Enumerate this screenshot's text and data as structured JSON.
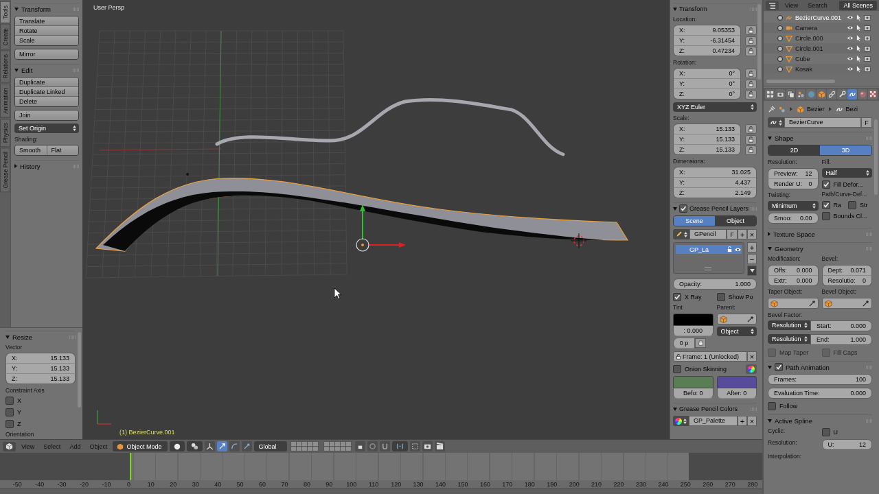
{
  "tool_tabs": [
    {
      "label": "Tools",
      "selected": true
    },
    {
      "label": "Create",
      "selected": false
    },
    {
      "label": "Relations",
      "selected": false
    },
    {
      "label": "Animation",
      "selected": false
    },
    {
      "label": "Physics",
      "selected": false
    },
    {
      "label": "Grease Pencil",
      "selected": false
    }
  ],
  "tool_shelf": {
    "rows": [
      {
        "kind": "section",
        "title": "Transform",
        "expanded": true
      },
      {
        "kind": "buttons",
        "labels": [
          "Translate",
          "Rotate",
          "Scale"
        ]
      },
      {
        "kind": "buttons",
        "labels": [
          "Mirror"
        ]
      },
      {
        "kind": "section",
        "title": "Edit",
        "expanded": true
      },
      {
        "kind": "buttons",
        "labels": [
          "Duplicate",
          "Duplicate Linked",
          "Delete"
        ]
      },
      {
        "kind": "buttons",
        "labels": [
          "Join"
        ]
      },
      {
        "kind": "dropdown",
        "value": "Set Origin"
      },
      {
        "kind": "label",
        "text": "Shading:"
      },
      {
        "kind": "pair",
        "labels": [
          "Smooth",
          "Flat"
        ]
      },
      {
        "kind": "section",
        "title": "History",
        "expanded": false
      }
    ]
  },
  "operator": {
    "rows": [
      {
        "kind": "section",
        "title": "Resize",
        "expanded": true
      },
      {
        "kind": "label",
        "text": "Vector"
      },
      {
        "kind": "fields",
        "locks": false,
        "items": [
          {
            "label": "X:",
            "value": "15.133"
          },
          {
            "label": "Y:",
            "value": "15.133"
          },
          {
            "label": "Z:",
            "value": "15.133"
          }
        ]
      },
      {
        "kind": "label",
        "text": "Constraint Axis"
      },
      {
        "kind": "checkbox",
        "label": "X",
        "checked": false
      },
      {
        "kind": "checkbox",
        "label": "Y",
        "checked": false
      },
      {
        "kind": "checkbox",
        "label": "Z",
        "checked": false
      },
      {
        "kind": "label",
        "text": "Orientation"
      }
    ]
  },
  "viewport": {
    "view_name": "User Persp",
    "object_info": "(1) BezierCurve.001"
  },
  "sidebar": {
    "rows": [
      {
        "kind": "section",
        "title": "Transform",
        "expanded": true
      },
      {
        "kind": "label",
        "text": "Location:"
      },
      {
        "kind": "fields",
        "locks": true,
        "items": [
          {
            "label": "X:",
            "value": "9.05353"
          },
          {
            "label": "Y:",
            "value": "-6.31454"
          },
          {
            "label": "Z:",
            "value": "0.47234"
          }
        ]
      },
      {
        "kind": "label",
        "text": "Rotation:"
      },
      {
        "kind": "fields",
        "locks": true,
        "items": [
          {
            "label": "X:",
            "value": "0°"
          },
          {
            "label": "Y:",
            "value": "0°"
          },
          {
            "label": "Z:",
            "value": "0°"
          }
        ]
      },
      {
        "kind": "dropdown",
        "value": "XYZ Euler"
      },
      {
        "kind": "label",
        "text": "Scale:"
      },
      {
        "kind": "fields",
        "locks": true,
        "items": [
          {
            "label": "X:",
            "value": "15.133"
          },
          {
            "label": "Y:",
            "value": "15.133"
          },
          {
            "label": "Z:",
            "value": "15.133"
          }
        ]
      },
      {
        "kind": "label",
        "text": "Dimensions:"
      },
      {
        "kind": "fields",
        "locks": false,
        "items": [
          {
            "label": "X:",
            "value": "31.025"
          },
          {
            "label": "Y:",
            "value": "4.437"
          },
          {
            "label": "Z:",
            "value": "2.149"
          }
        ]
      },
      {
        "kind": "section",
        "title": "Grease Pencil Layers",
        "expanded": true,
        "checked": true
      },
      {
        "kind": "segmented",
        "options": [
          {
            "label": "Scene",
            "selected": true
          },
          {
            "label": "Object",
            "selected": false
          }
        ]
      },
      {
        "kind": "gpencil_block",
        "name": "GPencil",
        "fake": "F",
        "buttons": [
          "+",
          "×"
        ]
      },
      {
        "kind": "layerlist",
        "items": [
          {
            "name": "GP_La",
            "selected": true
          }
        ],
        "side_buttons": [
          "+",
          "−"
        ]
      },
      {
        "kind": "field",
        "label": "Opacity:",
        "value": "1.000"
      },
      {
        "kind": "cols",
        "columns": [
          [
            {
              "kind": "checkbox",
              "label": "X Ray",
              "checked": true
            }
          ],
          [
            {
              "kind": "checkbox",
              "label": "Show Po",
              "checked": false
            }
          ]
        ]
      },
      {
        "kind": "cols",
        "columns": [
          [
            {
              "kind": "label",
              "text": "Tint"
            },
            {
              "kind": "swatch",
              "color": "#000000",
              "value": ": 0.000"
            },
            {
              "kind": "tiny",
              "value": "0 p"
            }
          ],
          [
            {
              "kind": "label",
              "text": "Parent:"
            },
            {
              "kind": "objectfield"
            },
            {
              "kind": "dropdown",
              "value": "Object"
            }
          ]
        ]
      },
      {
        "kind": "framerow",
        "value": "Frame: 1 (Unlocked)",
        "button": "×"
      },
      {
        "kind": "checkicon",
        "label": "Onion Skinning",
        "checked": false
      },
      {
        "kind": "cols",
        "columns": [
          [
            {
              "kind": "swatch",
              "color": "#5b7d55",
              "value": "Befo: 0"
            }
          ],
          [
            {
              "kind": "swatch",
              "color": "#574c9c",
              "value": "After: 0"
            }
          ]
        ]
      },
      {
        "kind": "section",
        "title": "Grease Pencil Colors",
        "expanded": true
      },
      {
        "kind": "palette_block",
        "name": "GP_Palette",
        "buttons": [
          "+",
          "×"
        ]
      }
    ]
  },
  "outliner": {
    "menus": [
      "View",
      "Search"
    ],
    "filter": "All Scenes",
    "items": [
      {
        "name": "BezierCurve.001",
        "kind": "curve",
        "active": true
      },
      {
        "name": "Camera",
        "kind": "camera",
        "active": false
      },
      {
        "name": "Circle.000",
        "kind": "mesh",
        "active": false
      },
      {
        "name": "Circle.001",
        "kind": "mesh",
        "active": false
      },
      {
        "name": "Cube",
        "kind": "mesh",
        "active": false
      },
      {
        "name": "Kosak",
        "kind": "mesh",
        "active": false
      }
    ]
  },
  "properties": {
    "rows": [
      {
        "kind": "prop_tabs",
        "tabs": [
          {
            "selected": false
          },
          {
            "selected": false
          },
          {
            "selected": false
          },
          {
            "selected": false
          },
          {
            "selected": false
          },
          {
            "selected": false
          },
          {
            "selected": false
          },
          {
            "selected": true
          },
          {
            "selected": false
          },
          {
            "selected": false
          }
        ]
      },
      {
        "kind": "breadcrumb",
        "parts": [
          "Bezier",
          "Bezi"
        ]
      },
      {
        "kind": "curve_block",
        "name": "BezierCurve",
        "fake": "F"
      },
      {
        "kind": "section",
        "title": "Shape",
        "expanded": true
      },
      {
        "kind": "segmented",
        "options": [
          {
            "label": "2D",
            "selected": false
          },
          {
            "label": "3D",
            "selected": true
          }
        ]
      },
      {
        "kind": "cols",
        "columns": [
          [
            {
              "kind": "label",
              "text": "Resolution:"
            },
            {
              "kind": "fields",
              "locks": false,
              "items": [
                {
                  "label": "Preview:",
                  "value": "12"
                },
                {
                  "label": "Render U:",
                  "value": "0"
                }
              ]
            },
            {
              "kind": "label",
              "text": "Twisting:"
            },
            {
              "kind": "dropdown",
              "value": "Minimum"
            },
            {
              "kind": "field",
              "label": "Smoo:",
              "value": "0.00"
            }
          ],
          [
            {
              "kind": "label",
              "text": "Fill:"
            },
            {
              "kind": "dropdown",
              "value": "Half"
            },
            {
              "kind": "checkbox",
              "label": "Fill Defor...",
              "checked": true
            },
            {
              "kind": "label",
              "text": "Path/Curve-Def..."
            },
            {
              "kind": "checkpair",
              "items": [
                {
                  "label": "Ra",
                  "checked": true
                },
                {
                  "label": "Str",
                  "checked": false
                }
              ]
            },
            {
              "kind": "checkbox",
              "label": "Bounds Cl...",
              "checked": false
            }
          ]
        ]
      },
      {
        "kind": "section",
        "title": "Texture Space",
        "expanded": false
      },
      {
        "kind": "section",
        "title": "Geometry",
        "expanded": true
      },
      {
        "kind": "cols",
        "columns": [
          [
            {
              "kind": "label",
              "text": "Modification:"
            },
            {
              "kind": "fields",
              "locks": false,
              "items": [
                {
                  "label": "Offs:",
                  "value": "0.000"
                },
                {
                  "label": "Extr:",
                  "value": "0.000"
                }
              ]
            },
            {
              "kind": "label",
              "text": "Taper Object:"
            },
            {
              "kind": "objectfield"
            }
          ],
          [
            {
              "kind": "label",
              "text": "Bevel:"
            },
            {
              "kind": "fields",
              "locks": false,
              "items": [
                {
                  "label": "Dept:",
                  "value": "0.071"
                },
                {
                  "label": "Resolutio:",
                  "value": "0"
                }
              ]
            },
            {
              "kind": "label",
              "text": "Bevel Object:"
            },
            {
              "kind": "objectfield"
            }
          ]
        ]
      },
      {
        "kind": "label",
        "text": "Bevel Factor:"
      },
      {
        "kind": "combo",
        "option": "Resolution",
        "label": "Start:",
        "value": "0.000"
      },
      {
        "kind": "combo",
        "option": "Resolution",
        "label": "End:",
        "value": "1.000"
      },
      {
        "kind": "cols",
        "columns": [
          [
            {
              "kind": "checkbox",
              "label": "Map Taper",
              "checked": false,
              "disabled": true
            }
          ],
          [
            {
              "kind": "checkbox",
              "label": "Fill Caps",
              "checked": false,
              "disabled": true
            }
          ]
        ]
      },
      {
        "kind": "section",
        "title": "Path Animation",
        "expanded": true,
        "checked": true
      },
      {
        "kind": "field",
        "label": "Frames:",
        "value": "100"
      },
      {
        "kind": "field",
        "label": "Evaluation Time:",
        "value": "0.000"
      },
      {
        "kind": "checkbox",
        "label": "Follow",
        "checked": false
      },
      {
        "kind": "section",
        "title": "Active Spline",
        "expanded": true
      },
      {
        "kind": "cols",
        "columns": [
          [
            {
              "kind": "label",
              "text": "Cyclic:"
            }
          ],
          [
            {
              "kind": "checkbox",
              "label": "U",
              "checked": false
            }
          ]
        ]
      },
      {
        "kind": "cols",
        "columns": [
          [
            {
              "kind": "label",
              "text": "Resolution:"
            }
          ],
          [
            {
              "kind": "field",
              "label": "U:",
              "value": "12"
            }
          ]
        ]
      },
      {
        "kind": "label",
        "text": "Interpolation:"
      }
    ]
  },
  "header": {
    "menus": [
      "View",
      "Select",
      "Add",
      "Object"
    ],
    "mode": "Object Mode",
    "orientation": "Global"
  },
  "timeline": {
    "ticks": [
      "-50",
      "-40",
      "-30",
      "-20",
      "-10",
      "0",
      "10",
      "20",
      "30",
      "40",
      "50",
      "60",
      "70",
      "80",
      "90",
      "100",
      "110",
      "120",
      "130",
      "140",
      "150",
      "160",
      "170",
      "180",
      "190",
      "200",
      "210",
      "220",
      "230",
      "240",
      "250",
      "260",
      "270",
      "280"
    ],
    "playhead": {
      "level": 0.171
    },
    "range_end": {
      "level": 0.904
    }
  }
}
